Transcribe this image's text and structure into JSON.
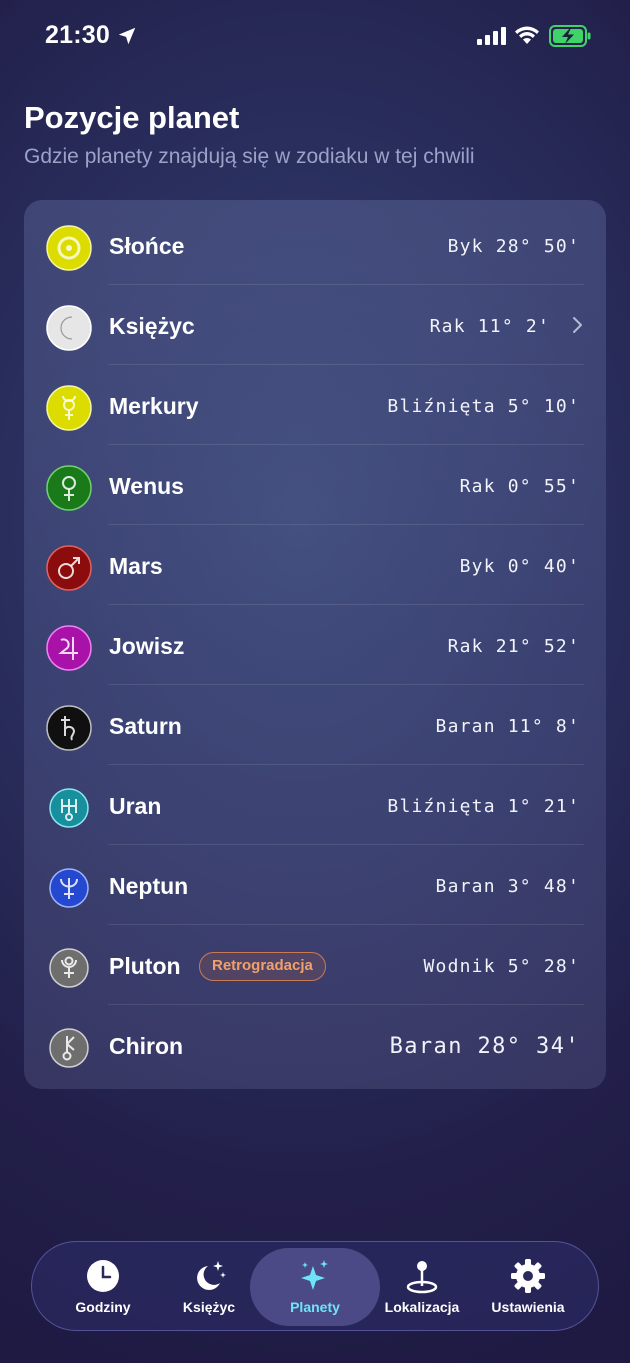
{
  "status_bar": {
    "time": "21:30"
  },
  "header": {
    "title": "Pozycje planet",
    "subtitle": "Gdzie planety znajdują się w zodiaku w tej chwili"
  },
  "planets": [
    {
      "name": "Słońce",
      "position": "Byk 28° 50'",
      "icon": "sun-icon",
      "color": "#e8e400"
    },
    {
      "name": "Księżyc",
      "position": "Rak 11° 2'",
      "icon": "moon-icon",
      "color": "#e8e8e8"
    },
    {
      "name": "Merkury",
      "position": "Bliźnięta 5° 10'",
      "icon": "mercury-icon",
      "color": "#e8e400"
    },
    {
      "name": "Wenus",
      "position": "Rak 0° 55'",
      "icon": "venus-icon",
      "color": "#1f8a1f"
    },
    {
      "name": "Mars",
      "position": "Byk 0° 40'",
      "icon": "mars-icon",
      "color": "#9a1010"
    },
    {
      "name": "Jowisz",
      "position": "Rak 21° 52'",
      "icon": "jupiter-icon",
      "color": "#b016b0"
    },
    {
      "name": "Saturn",
      "position": "Baran 11° 8'",
      "icon": "saturn-icon",
      "color": "#151515"
    },
    {
      "name": "Uran",
      "position": "Bliźnięta 1° 21'",
      "icon": "uranus-icon",
      "color": "#1e9aa8"
    },
    {
      "name": "Neptun",
      "position": "Baran 3° 48'",
      "icon": "neptune-icon",
      "color": "#2a52d8"
    },
    {
      "name": "Pluton",
      "position": "Wodnik 5° 28'",
      "icon": "pluto-icon",
      "color": "#7a7a7a",
      "badge": "Retrogradacja"
    },
    {
      "name": "Chiron",
      "position": "Baran 28° 34'",
      "icon": "chiron-icon",
      "color": "#7a7a7a"
    }
  ],
  "tabs": [
    {
      "label": "Godziny",
      "icon": "clock-icon"
    },
    {
      "label": "Księżyc",
      "icon": "moon-stars-icon"
    },
    {
      "label": "Planety",
      "icon": "sparkles-icon",
      "active": true
    },
    {
      "label": "Lokalizacja",
      "icon": "location-pin-icon"
    },
    {
      "label": "Ustawienia",
      "icon": "gear-icon"
    }
  ],
  "colors": {
    "accent": "#6fe4f7",
    "badge_text": "#f1a06b",
    "subtitle": "#9aa2c7"
  }
}
